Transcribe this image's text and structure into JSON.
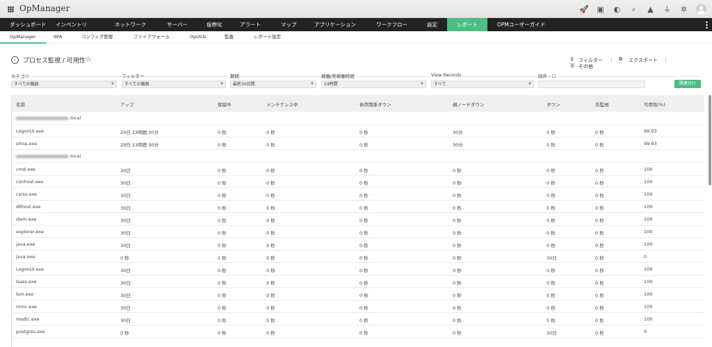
{
  "app": {
    "title": "OpManager"
  },
  "top_icons": [
    "rocket-icon",
    "presentation-icon",
    "headset-icon",
    "search-icon",
    "bell-icon",
    "plug-icon",
    "gear-icon"
  ],
  "main_nav": [
    {
      "label": "ダッシュボード",
      "active": false
    },
    {
      "label": "インベントリ",
      "active": false
    },
    {
      "label": "ネットワーク",
      "active": false
    },
    {
      "label": "サーバー",
      "active": false
    },
    {
      "label": "仮想化",
      "active": false
    },
    {
      "label": "アラート",
      "active": false
    },
    {
      "label": "マップ",
      "active": false
    },
    {
      "label": "アプリケーション",
      "active": false
    },
    {
      "label": "ワークフロー",
      "active": false
    },
    {
      "label": "設定",
      "active": false
    },
    {
      "label": "レポート",
      "active": true
    },
    {
      "label": "OPMユーザーガイド",
      "active": false
    }
  ],
  "sub_nav": [
    {
      "label": "OpManager",
      "active": true
    },
    {
      "label": "NFA"
    },
    {
      "label": "コンフィグ管理"
    },
    {
      "label": "ファイアウォール"
    },
    {
      "label": "OpUtils"
    },
    {
      "label": "監査"
    },
    {
      "label": "レポート設定"
    }
  ],
  "page": {
    "title": "プロセス監視 / 可用性",
    "filter_label": "フィルター",
    "export_label": "エクスポート",
    "more_label": "その他"
  },
  "filters": {
    "category": {
      "label": "カテゴリ",
      "value": "すべての機器"
    },
    "filter": {
      "label": "フィルター",
      "value": "すべての機器"
    },
    "period": {
      "label": "期間",
      "value": "最新30日間"
    },
    "uptime": {
      "label": "稼働/実稼働時間",
      "value": "24時間"
    },
    "view_records": {
      "label": "View Records",
      "value": "すべて"
    },
    "exclude": {
      "label": "除外 : ☐",
      "value": ""
    },
    "submit_label": "関連付け"
  },
  "colors": {
    "accent": "#4cbf83",
    "nav_bg": "#222222"
  },
  "table": {
    "headers": [
      "名前",
      "アップ",
      "保留中",
      "メンテナンス中",
      "依存関係ダウン",
      "親ノードダウン",
      "ダウン",
      "非監視",
      "可用性(%)"
    ],
    "groups": [
      {
        "host_suffix": ".local",
        "rows": [
          [
            "LogonUI.exe",
            "29日 23時間 30分",
            "0 秒",
            "0 秒",
            "0 秒",
            "30分",
            "0 秒",
            "0 秒",
            "99.93"
          ],
          [
            "smss.exe",
            "29日 23時間 30分",
            "0 秒",
            "0 秒",
            "0 秒",
            "30分",
            "0 秒",
            "0 秒",
            "99.93"
          ]
        ]
      },
      {
        "host_suffix": ".local",
        "rows": [
          [
            "cmd.exe",
            "30日",
            "0 秒",
            "0 秒",
            "0 秒",
            "0 秒",
            "0 秒",
            "0 秒",
            "100"
          ],
          [
            "conhost.exe",
            "30日",
            "0 秒",
            "0 秒",
            "0 秒",
            "0 秒",
            "0 秒",
            "0 秒",
            "100"
          ],
          [
            "csrss.exe",
            "30日",
            "0 秒",
            "0 秒",
            "0 秒",
            "0 秒",
            "0 秒",
            "0 秒",
            "100"
          ],
          [
            "dllhost.exe",
            "30日",
            "0 秒",
            "0 秒",
            "0 秒",
            "0 秒",
            "0 秒",
            "0 秒",
            "100"
          ],
          [
            "dwm.exe",
            "30日",
            "0 秒",
            "0 秒",
            "0 秒",
            "0 秒",
            "0 秒",
            "0 秒",
            "100"
          ],
          [
            "explorer.exe",
            "30日",
            "0 秒",
            "0 秒",
            "0 秒",
            "0 秒",
            "0 秒",
            "0 秒",
            "100"
          ],
          [
            "java.exe",
            "30日",
            "0 秒",
            "0 秒",
            "0 秒",
            "0 秒",
            "0 秒",
            "0 秒",
            "100"
          ],
          [
            "java.exe",
            "0 秒",
            "0 秒",
            "0 秒",
            "0 秒",
            "0 秒",
            "30日",
            "0 秒",
            "0"
          ],
          [
            "LogonUI.exe",
            "30日",
            "0 秒",
            "0 秒",
            "0 秒",
            "0 秒",
            "0 秒",
            "0 秒",
            "100"
          ],
          [
            "lsass.exe",
            "30日",
            "0 秒",
            "0 秒",
            "0 秒",
            "0 秒",
            "0 秒",
            "0 秒",
            "100"
          ],
          [
            "lsm.exe",
            "30日",
            "0 秒",
            "0 秒",
            "0 秒",
            "0 秒",
            "0 秒",
            "0 秒",
            "100"
          ],
          [
            "mmc.exe",
            "30日",
            "0 秒",
            "0 秒",
            "0 秒",
            "0 秒",
            "0 秒",
            "0 秒",
            "100"
          ],
          [
            "msdtc.exe",
            "30日",
            "0 秒",
            "0 秒",
            "0 秒",
            "0 秒",
            "0 秒",
            "0 秒",
            "100"
          ],
          [
            "postgres.exe",
            "0 秒",
            "0 秒",
            "0 秒",
            "0 秒",
            "0 秒",
            "30日",
            "0 秒",
            "0"
          ]
        ]
      }
    ]
  }
}
